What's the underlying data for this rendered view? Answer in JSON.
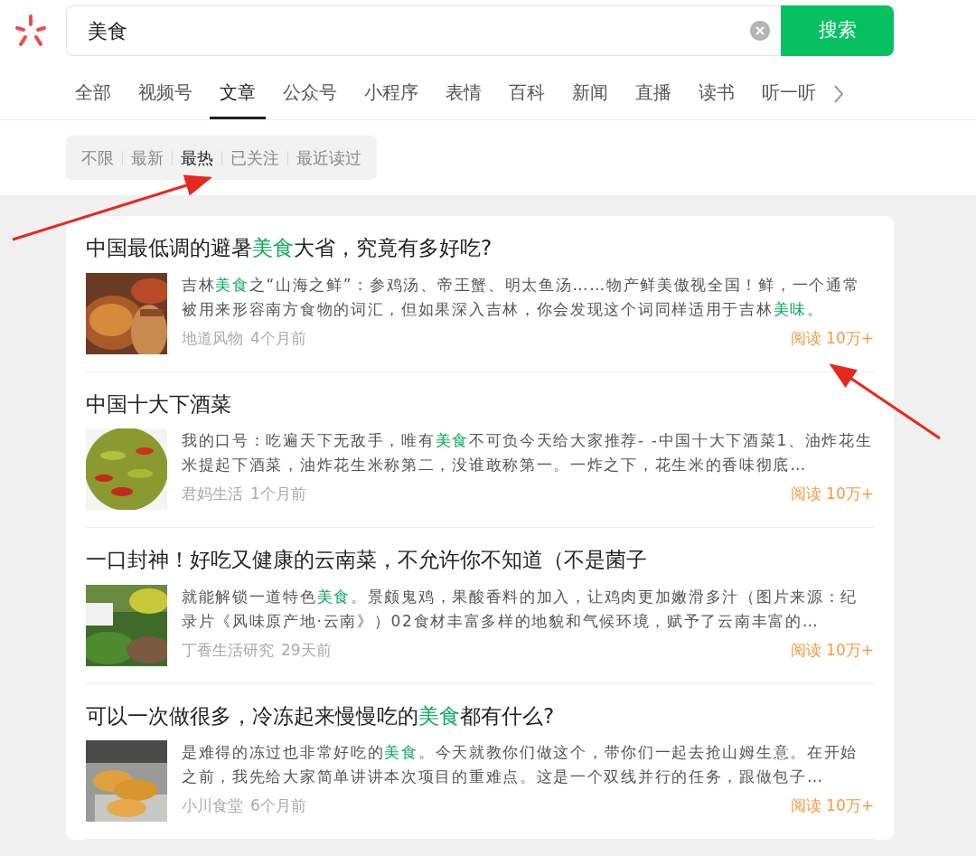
{
  "search": {
    "value": "美食",
    "button": "搜索"
  },
  "tabs": [
    {
      "label": "全部",
      "selected": false
    },
    {
      "label": "视频号",
      "selected": false
    },
    {
      "label": "文章",
      "selected": true
    },
    {
      "label": "公众号",
      "selected": false
    },
    {
      "label": "小程序",
      "selected": false
    },
    {
      "label": "表情",
      "selected": false
    },
    {
      "label": "百科",
      "selected": false
    },
    {
      "label": "新闻",
      "selected": false
    },
    {
      "label": "直播",
      "selected": false
    },
    {
      "label": "读书",
      "selected": false
    },
    {
      "label": "听一听",
      "selected": false
    }
  ],
  "filters": [
    {
      "label": "不限",
      "selected": false
    },
    {
      "label": "最新",
      "selected": false
    },
    {
      "label": "最热",
      "selected": true
    },
    {
      "label": "已关注",
      "selected": false
    },
    {
      "label": "最近读过",
      "selected": false
    }
  ],
  "articles": [
    {
      "title": "中国最低调的避暑**美食**大省，究竟有多好吃?",
      "summary": "吉林**美食**之“山海之鲜”：参鸡汤、帝王蟹、明太鱼汤……物产鲜美傲视全国！鲜，一个通常被用来形容南方食物的词汇，但如果深入吉林，你会发现这个词同样适用于吉林**美味**。",
      "source": "地道风物",
      "time": "4个月前",
      "reads": "阅读 10万+"
    },
    {
      "title": "中国十大下酒菜",
      "summary": "我的口号：吃遍天下无敌手，唯有**美食**不可负今天给大家推荐- -中国十大下酒菜1、油炸花生米提起下酒菜，油炸花生米称第二，没谁敢称第一。一炸之下，花生米的香味彻底…",
      "source": "君妈生活",
      "time": "1个月前",
      "reads": "阅读 10万+"
    },
    {
      "title": "一口封神！好吃又健康的云南菜，不允许你不知道（不是菌子",
      "summary": "就能解锁一道特色**美食**。景颇鬼鸡，果酸香料的加入，让鸡肉更加嫩滑多汁（图片来源：纪录片《风味原产地·云南》）02食材丰富多样的地貌和气候环境，赋予了云南丰富的…",
      "source": "丁香生活研究",
      "time": "29天前",
      "reads": "阅读 10万+"
    },
    {
      "title": "可以一次做很多，冷冻起来慢慢吃的**美食**都有什么?",
      "summary": "是难得的冻过也非常好吃的**美食**。今天就教你们做这个，带你们一起去抢山姆生意。在开始之前，我先给大家简单讲讲本次项目的重难点。这是一个双线并行的任务，跟做包子…",
      "source": "小川食堂",
      "time": "6个月前",
      "reads": "阅读 10万+"
    }
  ]
}
